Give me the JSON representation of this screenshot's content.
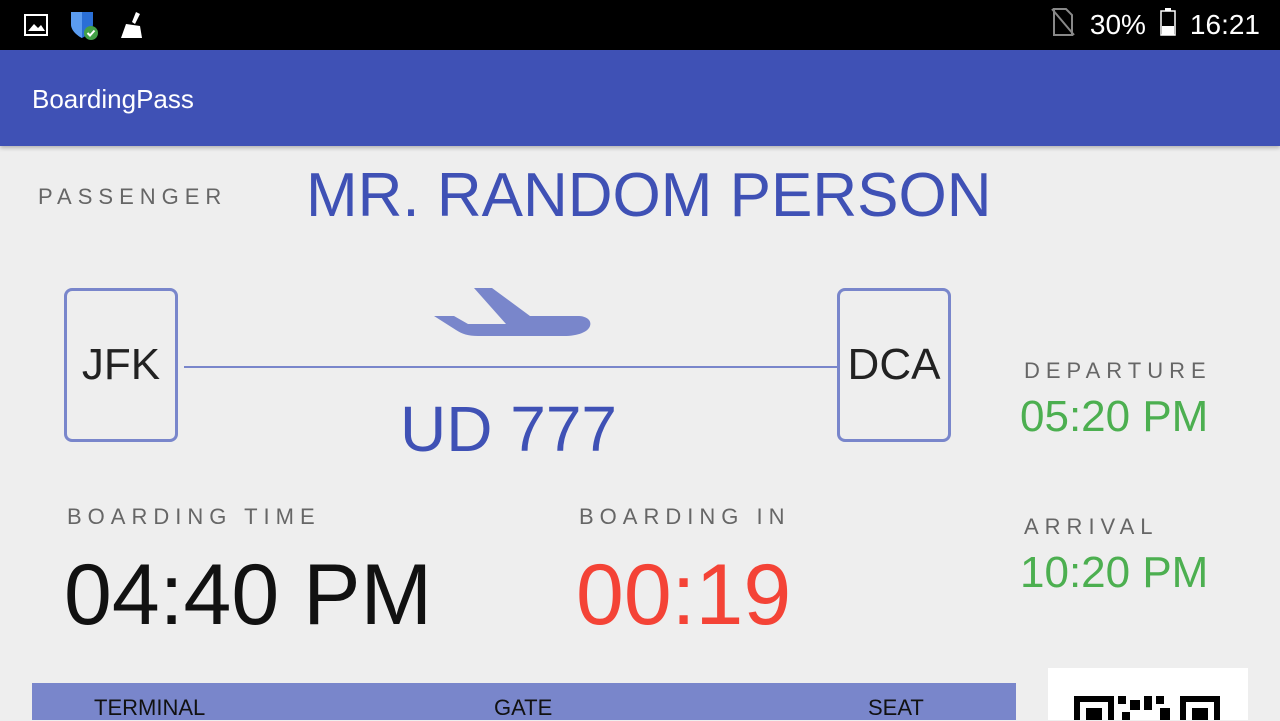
{
  "status_bar": {
    "battery": "30%",
    "time": "16:21"
  },
  "app_bar": {
    "title": "BoardingPass"
  },
  "passenger": {
    "label": "PASSENGER",
    "name": "MR. RANDOM PERSON"
  },
  "route": {
    "origin": "JFK",
    "destination": "DCA",
    "flight_number": "UD 777"
  },
  "boarding_time": {
    "label": "BOARDING TIME",
    "value": "04:40 PM"
  },
  "boarding_in": {
    "label": "BOARDING IN",
    "value": "00:19"
  },
  "departure": {
    "label": "DEPARTURE",
    "value": "05:20 PM"
  },
  "arrival": {
    "label": "ARRIVAL",
    "value": "10:20 PM"
  },
  "details": {
    "terminal_label": "TERMINAL",
    "gate_label": "GATE",
    "seat_label": "SEAT"
  },
  "colors": {
    "primary": "#3f51b5",
    "accent_line": "#7986cb",
    "countdown": "#f44336",
    "schedule": "#4caf50"
  }
}
